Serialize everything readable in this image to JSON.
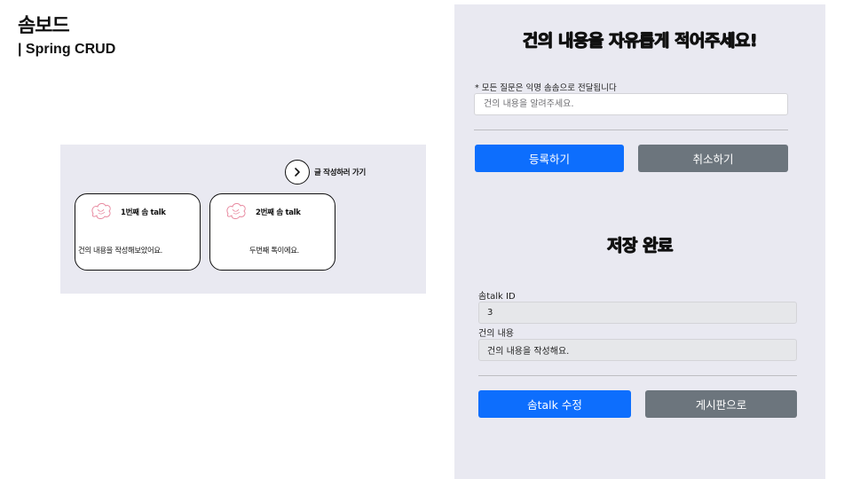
{
  "page": {
    "title": "솜보드",
    "subtitle": "| Spring CRUD"
  },
  "board": {
    "write_link": "글 작성하러 가기",
    "write_icon": "chevron-right-icon",
    "cards": [
      {
        "title": "1번째 솜 talk",
        "body": "건의 내용을 작성해보았어요.",
        "icon": "cotton-icon"
      },
      {
        "title": "2번째 솜 talk",
        "body": "두번째 톡이에요.",
        "icon": "cotton-icon"
      }
    ]
  },
  "form": {
    "heading": "건의 내용을 자유롭게 적어주세요!",
    "notice": "* 모든 질문은 익명 솜솜으로 전달됩니다",
    "placeholder": "건의 내용을 알려주세요.",
    "register_label": "등록하기",
    "cancel_label": "취소하기"
  },
  "saved": {
    "heading": "저장 완료",
    "id_label": "솜talk ID",
    "id_value": "3",
    "content_label": "건의 내용",
    "content_value": "건의 내용을 작성해요.",
    "edit_label": "솜talk 수정",
    "board_label": "게시판으로"
  },
  "colors": {
    "panel_bg": "#e9e9f1",
    "primary": "#0d6efd",
    "secondary": "#6c757d",
    "icon_pink": "#e88aa0"
  }
}
